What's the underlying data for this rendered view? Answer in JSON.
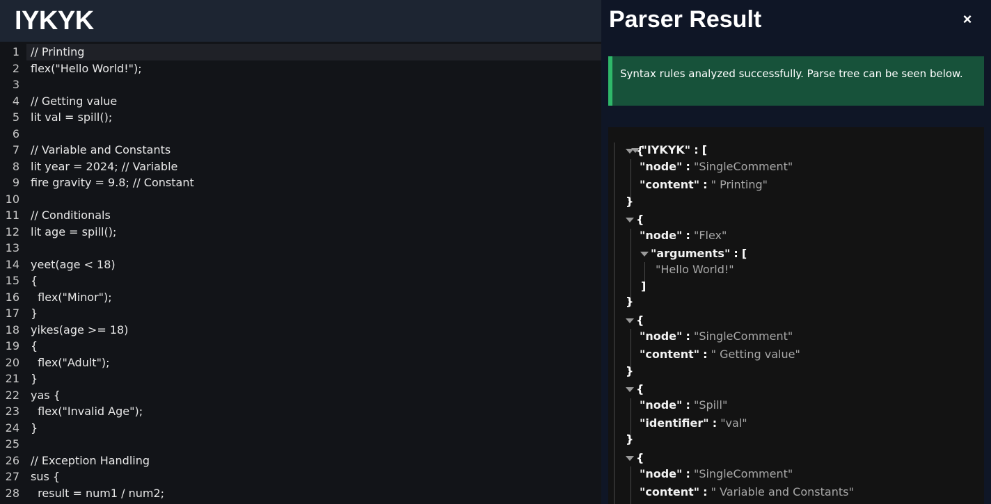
{
  "app": {
    "logo": "IYKYK"
  },
  "editor": {
    "lines": [
      {
        "n": "1",
        "code": "// Printing"
      },
      {
        "n": "2",
        "code": "flex(\"Hello World!\");"
      },
      {
        "n": "3",
        "code": ""
      },
      {
        "n": "4",
        "code": "// Getting value"
      },
      {
        "n": "5",
        "code": "lit val = spill();"
      },
      {
        "n": "6",
        "code": ""
      },
      {
        "n": "7",
        "code": "// Variable and Constants"
      },
      {
        "n": "8",
        "code": "lit year = 2024; // Variable"
      },
      {
        "n": "9",
        "code": "fire gravity = 9.8; // Constant"
      },
      {
        "n": "10",
        "code": ""
      },
      {
        "n": "11",
        "code": "// Conditionals"
      },
      {
        "n": "12",
        "code": "lit age = spill();"
      },
      {
        "n": "13",
        "code": ""
      },
      {
        "n": "14",
        "code": "yeet(age < 18)"
      },
      {
        "n": "15",
        "code": "{"
      },
      {
        "n": "16",
        "code": "  flex(\"Minor\");"
      },
      {
        "n": "17",
        "code": "}"
      },
      {
        "n": "18",
        "code": "yikes(age >= 18)"
      },
      {
        "n": "19",
        "code": "{"
      },
      {
        "n": "20",
        "code": "  flex(\"Adult\");"
      },
      {
        "n": "21",
        "code": "}"
      },
      {
        "n": "22",
        "code": "yas {"
      },
      {
        "n": "23",
        "code": "  flex(\"Invalid Age\");"
      },
      {
        "n": "24",
        "code": "}"
      },
      {
        "n": "25",
        "code": ""
      },
      {
        "n": "26",
        "code": "// Exception Handling"
      },
      {
        "n": "27",
        "code": "sus {"
      },
      {
        "n": "28",
        "code": "  result = num1 / num2;"
      }
    ]
  },
  "panel": {
    "title": "Parser Result",
    "close_label": "×",
    "alert": "Syntax rules analyzed successfully. Parse tree can be seen below."
  },
  "tree": {
    "root_key": "\"IYKYK\"",
    "sep": ":",
    "open_bracket": "[",
    "close_bracket": "]",
    "open_brace": "{",
    "close_brace": "}",
    "node_key": "\"node\"",
    "content_key": "\"content\"",
    "arguments_key": "\"arguments\"",
    "identifier_key": "\"identifier\"",
    "n1_node": "\"SingleComment\"",
    "n1_content": "\" Printing\"",
    "n2_node": "\"Flex\"",
    "n2_arg": "\"Hello World!\"",
    "n3_node": "\"SingleComment\"",
    "n3_content": "\" Getting value\"",
    "n4_node": "\"Spill\"",
    "n4_identifier": "\"val\"",
    "n5_node": "\"SingleComment\"",
    "n5_content": "\" Variable and Constants\""
  }
}
